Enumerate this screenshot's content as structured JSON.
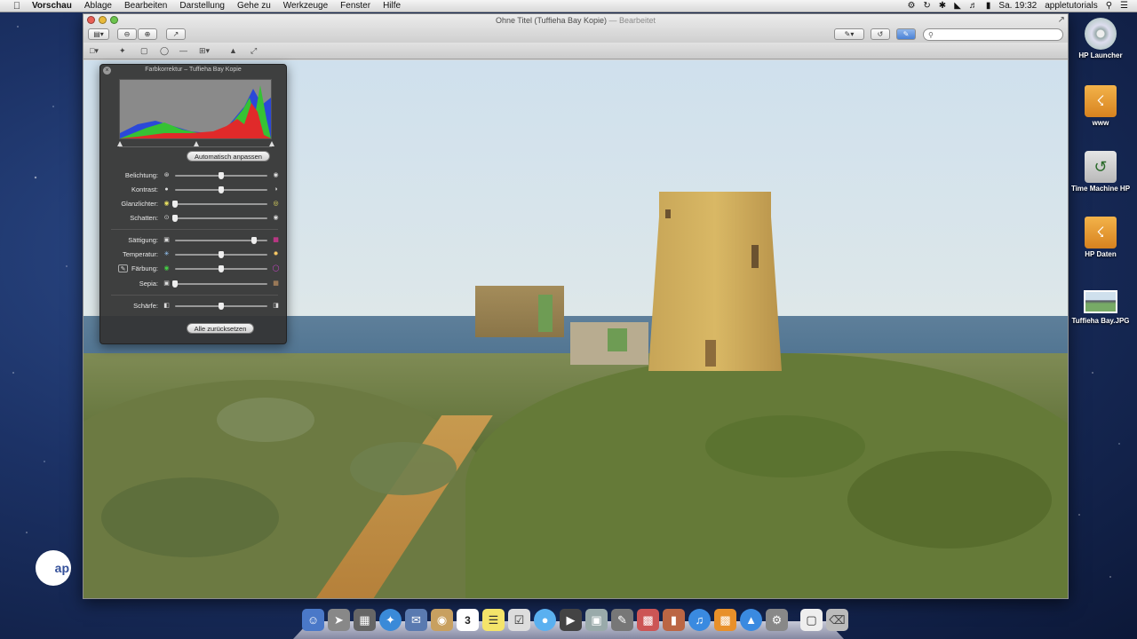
{
  "menubar": {
    "app_name": "Vorschau",
    "items": [
      "Ablage",
      "Bearbeiten",
      "Darstellung",
      "Gehe zu",
      "Werkzeuge",
      "Fenster",
      "Hilfe"
    ],
    "clock": "Sa. 19:32",
    "user": "appletutorials"
  },
  "window": {
    "title": "Ohne Titel (Tuffieha Bay Kopie)",
    "title_suffix": "— Bearbeitet"
  },
  "panel": {
    "title": "Farbkorrektur – Tuffieha Bay Kopie",
    "auto_button": "Automatisch anpassen",
    "reset_button": "Alle zurücksetzen",
    "sliders": [
      {
        "label": "Belichtung:",
        "value": 0.5
      },
      {
        "label": "Kontrast:",
        "value": 0.5
      },
      {
        "label": "Glanzlichter:",
        "value": 0.0
      },
      {
        "label": "Schatten:",
        "value": 0.0
      },
      {
        "label": "Sättigung:",
        "value": 0.86
      },
      {
        "label": "Temperatur:",
        "value": 0.5
      },
      {
        "label": "Färbung:",
        "value": 0.5
      },
      {
        "label": "Sepia:",
        "value": 0.0
      },
      {
        "label": "Schärfe:",
        "value": 0.5
      }
    ]
  },
  "desktop": {
    "icons": [
      {
        "label": "HP Launcher"
      },
      {
        "label": "www"
      },
      {
        "label": "Time Machine HP"
      },
      {
        "label": "HP Daten"
      },
      {
        "label": "Tuffieha Bay.JPG"
      }
    ]
  },
  "watermark": {
    "text": "ap"
  },
  "calendar_day": "3"
}
